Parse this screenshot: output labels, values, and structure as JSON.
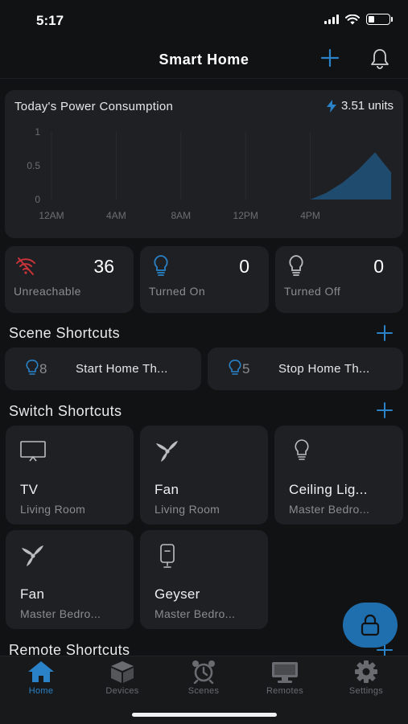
{
  "status_bar": {
    "time": "5:17"
  },
  "header": {
    "title": "Smart Home"
  },
  "power": {
    "title": "Today's Power Consumption",
    "value": "3.51 units"
  },
  "chart_data": {
    "type": "area",
    "title": "",
    "x": [
      "12AM",
      "4AM",
      "8AM",
      "12PM",
      "4PM"
    ],
    "yticks": [
      "1",
      "0.5",
      "0"
    ],
    "ylim": [
      0,
      1
    ],
    "series": [
      {
        "hours": [
          0,
          16,
          17,
          18,
          19,
          20,
          21
        ],
        "values": [
          0,
          0,
          0.1,
          0.25,
          0.45,
          0.7,
          0.4
        ]
      }
    ],
    "accent": "#1f6fae"
  },
  "stats": [
    {
      "value": "36",
      "label": "Unreachable",
      "icon": "wifi-off-icon"
    },
    {
      "value": "0",
      "label": "Turned On",
      "icon": "bulb-on-icon"
    },
    {
      "value": "0",
      "label": "Turned Off",
      "icon": "bulb-off-icon"
    }
  ],
  "scene_section": {
    "title": "Scene Shortcuts"
  },
  "scenes": [
    {
      "count": "8",
      "name": "Start Home Th..."
    },
    {
      "count": "5",
      "name": "Stop Home Th..."
    }
  ],
  "switch_section": {
    "title": "Switch Shortcuts"
  },
  "switches": [
    {
      "name": "TV",
      "room": "Living Room",
      "icon": "tv-icon"
    },
    {
      "name": "Fan",
      "room": "Living Room",
      "icon": "fan-icon"
    },
    {
      "name": "Ceiling Lig...",
      "room": "Master Bedro...",
      "icon": "bulb-icon"
    },
    {
      "name": "Fan",
      "room": "Master Bedro...",
      "icon": "fan-icon"
    },
    {
      "name": "Geyser",
      "room": "Master Bedro...",
      "icon": "geyser-icon"
    }
  ],
  "remote_section": {
    "title": "Remote Shortcuts"
  },
  "tabs": [
    {
      "label": "Home",
      "icon": "home-icon",
      "active": true
    },
    {
      "label": "Devices",
      "icon": "cube-icon",
      "active": false
    },
    {
      "label": "Scenes",
      "icon": "alarm-clock-icon",
      "active": false
    },
    {
      "label": "Remotes",
      "icon": "monitor-icon",
      "active": false
    },
    {
      "label": "Settings",
      "icon": "gear-icon",
      "active": false
    }
  ],
  "colors": {
    "accent": "#2a82c9",
    "card": "#1f2023",
    "background": "#111214"
  }
}
